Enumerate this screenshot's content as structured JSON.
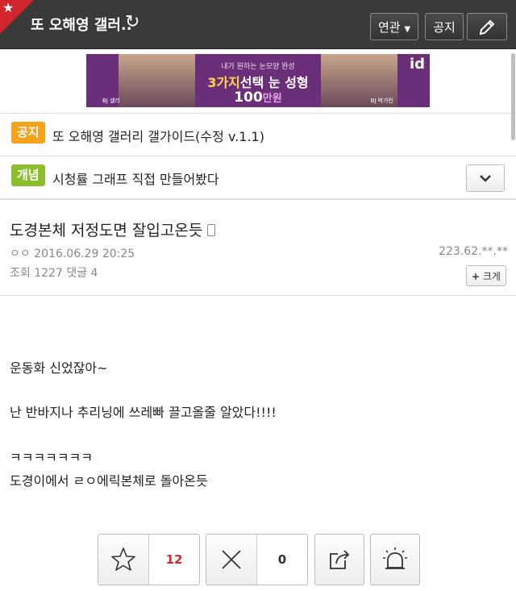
{
  "header": {
    "title": "또 오해영 갤러..",
    "related_label": "연관",
    "notice_label": "공지"
  },
  "banner": {
    "line1": "내가 원하는 눈모양 완성",
    "line2_prefix": "3가지",
    "line2_main": "선택 눈 성형",
    "line3_main": "100",
    "line3_suffix": "만원",
    "logo": "id",
    "tag_left": "BJ 셀리",
    "tag_right": "BJ 박가린"
  },
  "notice_row": {
    "badge": "공지",
    "text": "또 오해영 갤러리 갤가이드(수정 v.1.1)",
    "badge_color": "#f5a21c"
  },
  "concept_row": {
    "badge": "개념",
    "text": "시청률 그래프 직접 만들어봤다",
    "badge_color": "#8bbd2c"
  },
  "post": {
    "title": "도경본체 저정도면 잘입고온듯",
    "author": "ㅇㅇ",
    "date": "2016.06.29 20:25",
    "ip": "223.62.**.**",
    "views_label": "조회",
    "views": "1227",
    "comments_label": "댓글",
    "comments": "4",
    "bigger_label": "크게",
    "body": [
      "운동화 신었잖아~",
      "난 반바지나 추리닝에 쓰레빠 끌고올줄 알았다!!!!",
      "ㅋㅋㅋㅋㅋㅋㅋ",
      "도경이에서 ㄹㅇ에릭본체로 돌아온듯"
    ]
  },
  "votes": {
    "up": "12",
    "down": "0",
    "up_color": "#d3262c"
  }
}
